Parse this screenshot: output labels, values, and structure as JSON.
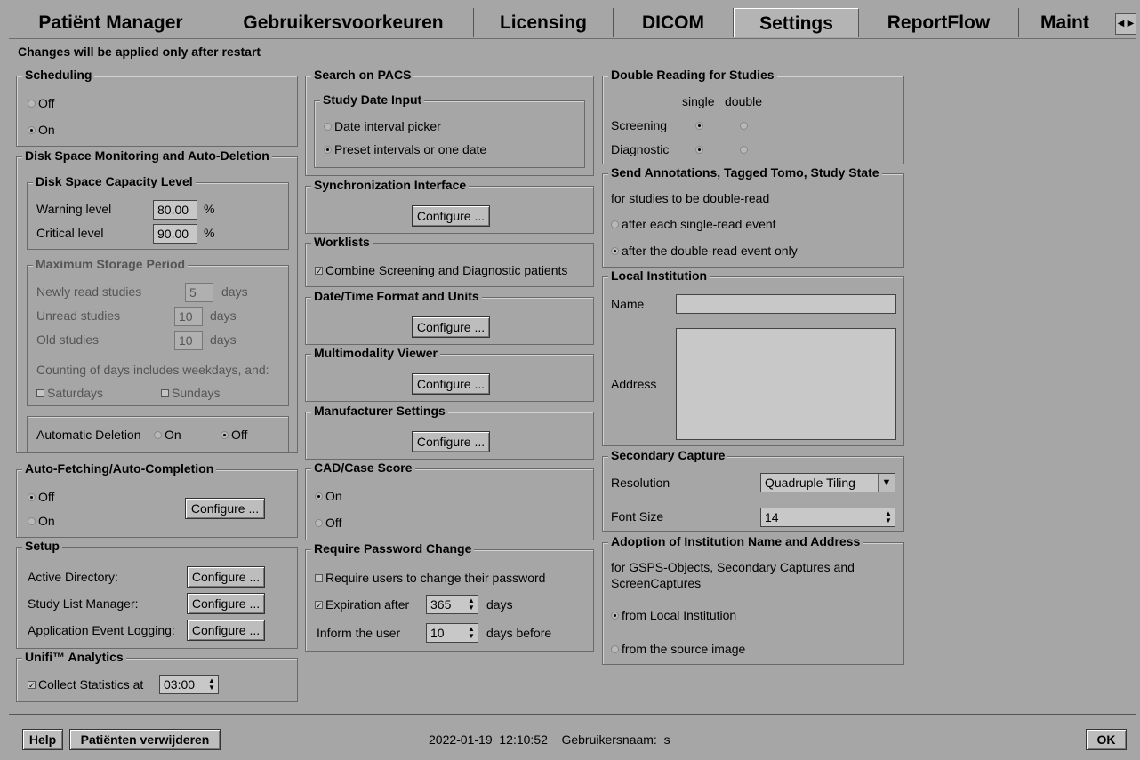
{
  "tabs": [
    {
      "label": "Patiënt Manager"
    },
    {
      "label": "Gebruikersvoorkeuren"
    },
    {
      "label": "Licensing"
    },
    {
      "label": "DICOM"
    },
    {
      "label": "Settings"
    },
    {
      "label": "ReportFlow"
    },
    {
      "label": "Maint"
    }
  ],
  "active_tab": "Settings",
  "notice": "Changes will be applied only after restart",
  "scheduling": {
    "title": "Scheduling",
    "off": "Off",
    "on": "On",
    "selected": "On"
  },
  "disk": {
    "title": "Disk Space Monitoring and Auto-Deletion",
    "capacity_title": "Disk Space Capacity Level",
    "warning_label": "Warning level",
    "warning_value": "80.00",
    "critical_label": "Critical level",
    "critical_value": "90.00",
    "percent": "%",
    "storage_title": "Maximum Storage Period",
    "newly_label": "Newly read studies",
    "newly_value": "5",
    "unread_label": "Unread studies",
    "unread_value": "10",
    "old_label": "Old studies",
    "old_value": "10",
    "days": "days",
    "counting_text": "Counting of days includes weekdays, and:",
    "saturdays": "Saturdays",
    "sundays": "Sundays",
    "auto_delete_label": "Automatic Deletion",
    "on": "On",
    "off": "Off",
    "auto_delete_selected": "Off"
  },
  "autofetch": {
    "title": "Auto-Fetching/Auto-Completion",
    "off": "Off",
    "on": "On",
    "selected": "Off",
    "configure": "Configure ..."
  },
  "setup": {
    "title": "Setup",
    "rows": [
      {
        "label": "Active Directory:",
        "button": "Configure ..."
      },
      {
        "label": "Study List Manager:",
        "button": "Configure ..."
      },
      {
        "label": "Application Event Logging:",
        "button": "Configure ..."
      }
    ]
  },
  "analytics": {
    "title": "Unifi™ Analytics",
    "checkbox_label": "Collect Statistics at",
    "time": "03:00",
    "checked": true
  },
  "search_pacs": {
    "title": "Search on PACS",
    "sub_title": "Study Date Input",
    "opt1": "Date interval picker",
    "opt2": "Preset intervals or one date",
    "selected": "Preset intervals or one date"
  },
  "sync": {
    "title": "Synchronization Interface",
    "configure": "Configure ..."
  },
  "worklists": {
    "title": "Worklists",
    "checkbox_label": "Combine Screening and Diagnostic patients",
    "checked": true
  },
  "datetime": {
    "title": "Date/Time Format and Units",
    "configure": "Configure ..."
  },
  "multimodality": {
    "title": "Multimodality Viewer",
    "configure": "Configure ..."
  },
  "manufacturer": {
    "title": "Manufacturer Settings",
    "configure": "Configure ..."
  },
  "cad": {
    "title": "CAD/Case Score",
    "on": "On",
    "off": "Off",
    "selected": "On"
  },
  "password": {
    "title": "Require Password Change",
    "require_label": "Require users to change their password",
    "require_checked": false,
    "expiration_label": "Expiration after",
    "expiration_value": "365",
    "expiration_checked": true,
    "inform_label": "Inform the user",
    "inform_value": "10",
    "days": "days",
    "days_before": "days before"
  },
  "double_reading": {
    "title": "Double Reading for Studies",
    "col_single": "single",
    "col_double": "double",
    "screening": "Screening",
    "screening_selected": "single",
    "diagnostic": "Diagnostic",
    "diagnostic_selected": "single"
  },
  "send_annotations": {
    "title": "Send Annotations, Tagged Tomo, Study State",
    "subtitle": "for studies to be double-read",
    "opt1": "after each single-read event",
    "opt2": "after the double-read event only",
    "selected": "after the double-read event only"
  },
  "local_institution": {
    "title": "Local Institution",
    "name_label": "Name",
    "name_value": "",
    "address_label": "Address",
    "address_value": ""
  },
  "secondary_capture": {
    "title": "Secondary Capture",
    "resolution_label": "Resolution",
    "resolution_value": "Quadruple Tiling",
    "font_label": "Font Size",
    "font_value": "14"
  },
  "adoption": {
    "title": "Adoption of Institution Name and Address",
    "desc": "for GSPS-Objects, Secondary Captures and ScreenCaptures",
    "opt1": "from Local Institution",
    "opt2": "from the source image",
    "selected": "from Local Institution"
  },
  "footer": {
    "help": "Help",
    "delete_patients": "Patiënten verwijderen",
    "status": "2022-01-19  12:10:52    Gebruikersnaam:  s",
    "ok": "OK"
  }
}
